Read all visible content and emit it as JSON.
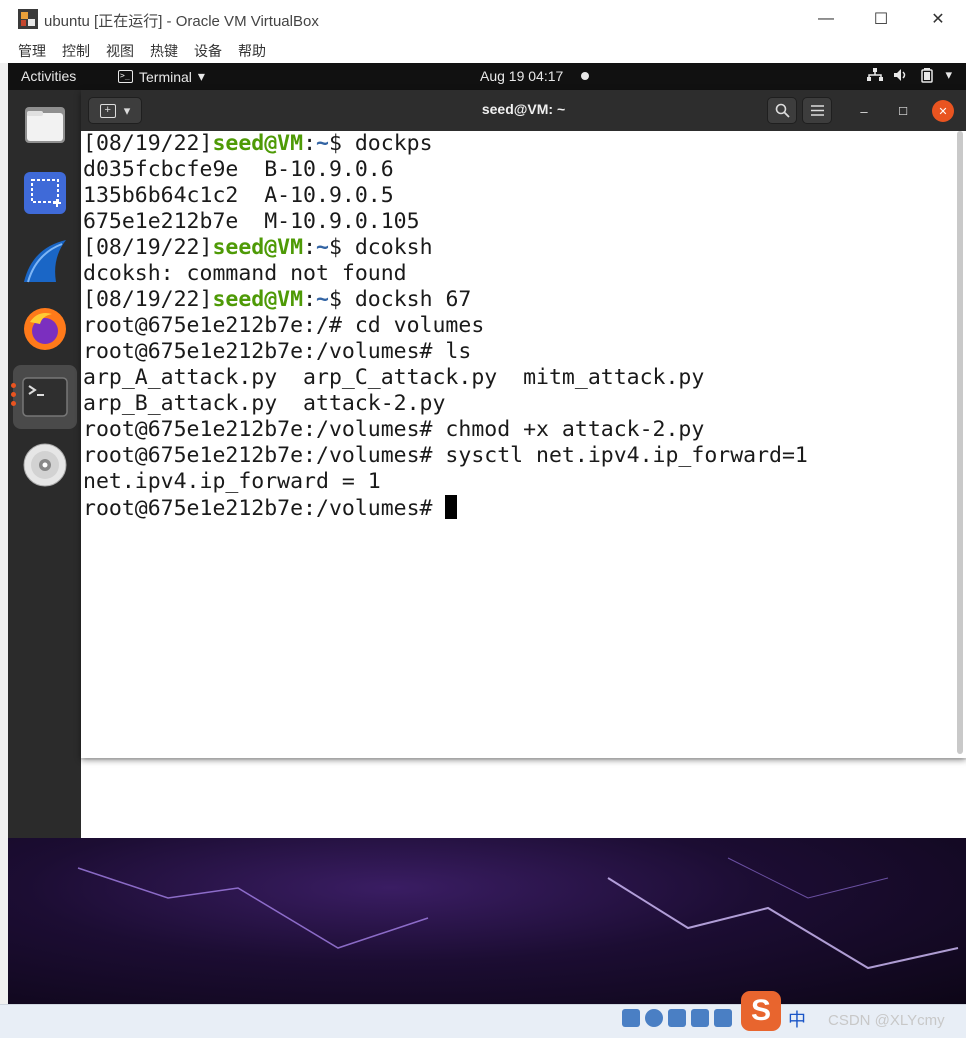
{
  "host": {
    "title": "ubuntu [正在运行] - Oracle VM VirtualBox",
    "menu": [
      "管理",
      "控制",
      "视图",
      "热键",
      "设备",
      "帮助"
    ],
    "buttons": {
      "minimize": "—",
      "maximize": "☐",
      "close": "✕"
    }
  },
  "topbar": {
    "activities": "Activities",
    "app_menu": "Terminal",
    "app_menu_arrow": "▾",
    "clock": "Aug 19  04:17",
    "tray_arrow": "▾"
  },
  "dock": {
    "items": [
      "files",
      "screenshot",
      "wireshark",
      "firefox",
      "terminal",
      "disc"
    ],
    "active": "terminal"
  },
  "terminal": {
    "title": "seed@VM: ~",
    "new_tab_symbol": "+",
    "menu_arrow": "▾",
    "win_min": "–",
    "win_max": "☐",
    "win_close": "✕",
    "user": "seed@VM",
    "lines": [
      {
        "type": "prompt",
        "date": "[08/19/22]",
        "user": "seed@VM",
        "sep": ":",
        "path": "~",
        "end": "$ ",
        "cmd": "dockps"
      },
      {
        "type": "output",
        "text": "d035fcbcfe9e  B-10.9.0.6"
      },
      {
        "type": "output",
        "text": "135b6b64c1c2  A-10.9.0.5"
      },
      {
        "type": "output",
        "text": "675e1e212b7e  M-10.9.0.105"
      },
      {
        "type": "prompt",
        "date": "[08/19/22]",
        "user": "seed@VM",
        "sep": ":",
        "path": "~",
        "end": "$ ",
        "cmd": "dcoksh"
      },
      {
        "type": "output",
        "text": "dcoksh: command not found"
      },
      {
        "type": "prompt",
        "date": "[08/19/22]",
        "user": "seed@VM",
        "sep": ":",
        "path": "~",
        "end": "$ ",
        "cmd": "docksh 67"
      },
      {
        "type": "output",
        "text": "root@675e1e212b7e:/# cd volumes"
      },
      {
        "type": "output",
        "text": "root@675e1e212b7e:/volumes# ls"
      },
      {
        "type": "output",
        "text": "arp_A_attack.py  arp_C_attack.py  mitm_attack.py"
      },
      {
        "type": "output",
        "text": "arp_B_attack.py  attack-2.py"
      },
      {
        "type": "output",
        "text": "root@675e1e212b7e:/volumes# chmod +x attack-2.py"
      },
      {
        "type": "output",
        "text": "root@675e1e212b7e:/volumes# sysctl net.ipv4.ip_forward=1"
      },
      {
        "type": "output",
        "text": "net.ipv4.ip_forward = 1"
      },
      {
        "type": "cursorline",
        "text": "root@675e1e212b7e:/volumes# "
      }
    ]
  },
  "taskbar": {
    "sogou": "S",
    "ime": "中",
    "watermark": "CSDN @XLYcmy"
  },
  "colors": {
    "prompt_user": "#4e9a06",
    "prompt_path": "#3465a4",
    "ubuntu_orange": "#e95420",
    "header": "#2d2d2d"
  }
}
